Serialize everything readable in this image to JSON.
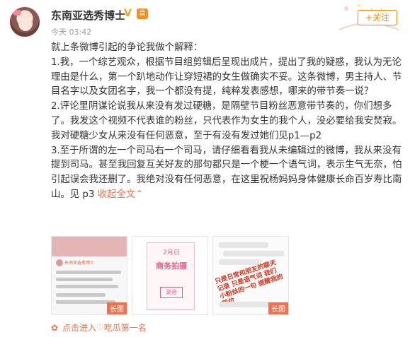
{
  "header": {
    "username": "东南亚选秀博士",
    "vip_badge": "V",
    "member_badge": "会",
    "time": "今天 03:42",
    "follow_label": "+关注"
  },
  "post": {
    "paragraphs": [
      "就上条微博引起的争论我做个解释：",
      "1.我，一个综艺观众，根据节目组剪辑后呈现出成片，提出了我的疑惑，我认为无论理由是什么，第一个趴地动作让穿短裙的女生做确实不妥。这条微博，男主持人、节目名字以及女团名字，我一个都没有提，纯粹发表感想，哪来的带节奏一说？",
      "2.评论里阴谋论说我从来没有发过硬糖，是隔壁节目粉丝恶意带节奏的，你们想多了。我发这个视频不代表谁的粉丝，只代表作为女生的我个人，没必要给我安焚寂。我对硬糖少女从来没有任何恶意，至于有没有发过她们见p1—p2",
      "3.至于所谓的左一个司马右一个司马，请仔细看看我从未编辑过的微博，我从来没有提到司马。甚至我回复互关好友的那句都只是一个梗一个语气词，表示生气无奈，怕引起误会我还删了。我绝对没有任何恶意，在这里祝杨妈妈身体健康长命百岁寿比南山。见 p3"
    ],
    "expand_label": "收起全文",
    "expand_icon": "chevron-up-icon"
  },
  "images": [
    {
      "tag": "长图",
      "username": "东南亚选秀博士"
    },
    {
      "tag": "",
      "card_lines": [
        "2月日",
        "商务拍摄",
        "录音"
      ]
    },
    {
      "tag": "长图",
      "note": "只是日常和朋友的聊天记录 只是语气词 我们小粉丝的一句 提醒我的那位"
    }
  ],
  "footer": {
    "text": "点击进入♡吃瓜第一名",
    "icon": "flower-icon"
  },
  "colors": {
    "accent": "#eb7350",
    "text": "#333333",
    "muted": "#999999",
    "follow": "#ff8200"
  }
}
